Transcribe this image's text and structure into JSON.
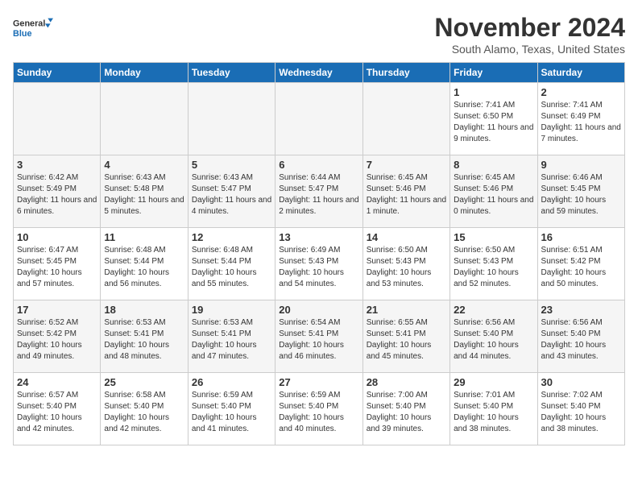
{
  "logo": {
    "line1": "General",
    "line2": "Blue"
  },
  "title": "November 2024",
  "location": "South Alamo, Texas, United States",
  "days_header": [
    "Sunday",
    "Monday",
    "Tuesday",
    "Wednesday",
    "Thursday",
    "Friday",
    "Saturday"
  ],
  "weeks": [
    [
      {
        "day": "",
        "text": "",
        "empty": true
      },
      {
        "day": "",
        "text": "",
        "empty": true
      },
      {
        "day": "",
        "text": "",
        "empty": true
      },
      {
        "day": "",
        "text": "",
        "empty": true
      },
      {
        "day": "",
        "text": "",
        "empty": true
      },
      {
        "day": "1",
        "text": "Sunrise: 7:41 AM\nSunset: 6:50 PM\nDaylight: 11 hours and 9 minutes.",
        "empty": false
      },
      {
        "day": "2",
        "text": "Sunrise: 7:41 AM\nSunset: 6:49 PM\nDaylight: 11 hours and 7 minutes.",
        "empty": false
      }
    ],
    [
      {
        "day": "3",
        "text": "Sunrise: 6:42 AM\nSunset: 5:49 PM\nDaylight: 11 hours and 6 minutes.",
        "empty": false
      },
      {
        "day": "4",
        "text": "Sunrise: 6:43 AM\nSunset: 5:48 PM\nDaylight: 11 hours and 5 minutes.",
        "empty": false
      },
      {
        "day": "5",
        "text": "Sunrise: 6:43 AM\nSunset: 5:47 PM\nDaylight: 11 hours and 4 minutes.",
        "empty": false
      },
      {
        "day": "6",
        "text": "Sunrise: 6:44 AM\nSunset: 5:47 PM\nDaylight: 11 hours and 2 minutes.",
        "empty": false
      },
      {
        "day": "7",
        "text": "Sunrise: 6:45 AM\nSunset: 5:46 PM\nDaylight: 11 hours and 1 minute.",
        "empty": false
      },
      {
        "day": "8",
        "text": "Sunrise: 6:45 AM\nSunset: 5:46 PM\nDaylight: 11 hours and 0 minutes.",
        "empty": false
      },
      {
        "day": "9",
        "text": "Sunrise: 6:46 AM\nSunset: 5:45 PM\nDaylight: 10 hours and 59 minutes.",
        "empty": false
      }
    ],
    [
      {
        "day": "10",
        "text": "Sunrise: 6:47 AM\nSunset: 5:45 PM\nDaylight: 10 hours and 57 minutes.",
        "empty": false
      },
      {
        "day": "11",
        "text": "Sunrise: 6:48 AM\nSunset: 5:44 PM\nDaylight: 10 hours and 56 minutes.",
        "empty": false
      },
      {
        "day": "12",
        "text": "Sunrise: 6:48 AM\nSunset: 5:44 PM\nDaylight: 10 hours and 55 minutes.",
        "empty": false
      },
      {
        "day": "13",
        "text": "Sunrise: 6:49 AM\nSunset: 5:43 PM\nDaylight: 10 hours and 54 minutes.",
        "empty": false
      },
      {
        "day": "14",
        "text": "Sunrise: 6:50 AM\nSunset: 5:43 PM\nDaylight: 10 hours and 53 minutes.",
        "empty": false
      },
      {
        "day": "15",
        "text": "Sunrise: 6:50 AM\nSunset: 5:43 PM\nDaylight: 10 hours and 52 minutes.",
        "empty": false
      },
      {
        "day": "16",
        "text": "Sunrise: 6:51 AM\nSunset: 5:42 PM\nDaylight: 10 hours and 50 minutes.",
        "empty": false
      }
    ],
    [
      {
        "day": "17",
        "text": "Sunrise: 6:52 AM\nSunset: 5:42 PM\nDaylight: 10 hours and 49 minutes.",
        "empty": false
      },
      {
        "day": "18",
        "text": "Sunrise: 6:53 AM\nSunset: 5:41 PM\nDaylight: 10 hours and 48 minutes.",
        "empty": false
      },
      {
        "day": "19",
        "text": "Sunrise: 6:53 AM\nSunset: 5:41 PM\nDaylight: 10 hours and 47 minutes.",
        "empty": false
      },
      {
        "day": "20",
        "text": "Sunrise: 6:54 AM\nSunset: 5:41 PM\nDaylight: 10 hours and 46 minutes.",
        "empty": false
      },
      {
        "day": "21",
        "text": "Sunrise: 6:55 AM\nSunset: 5:41 PM\nDaylight: 10 hours and 45 minutes.",
        "empty": false
      },
      {
        "day": "22",
        "text": "Sunrise: 6:56 AM\nSunset: 5:40 PM\nDaylight: 10 hours and 44 minutes.",
        "empty": false
      },
      {
        "day": "23",
        "text": "Sunrise: 6:56 AM\nSunset: 5:40 PM\nDaylight: 10 hours and 43 minutes.",
        "empty": false
      }
    ],
    [
      {
        "day": "24",
        "text": "Sunrise: 6:57 AM\nSunset: 5:40 PM\nDaylight: 10 hours and 42 minutes.",
        "empty": false
      },
      {
        "day": "25",
        "text": "Sunrise: 6:58 AM\nSunset: 5:40 PM\nDaylight: 10 hours and 42 minutes.",
        "empty": false
      },
      {
        "day": "26",
        "text": "Sunrise: 6:59 AM\nSunset: 5:40 PM\nDaylight: 10 hours and 41 minutes.",
        "empty": false
      },
      {
        "day": "27",
        "text": "Sunrise: 6:59 AM\nSunset: 5:40 PM\nDaylight: 10 hours and 40 minutes.",
        "empty": false
      },
      {
        "day": "28",
        "text": "Sunrise: 7:00 AM\nSunset: 5:40 PM\nDaylight: 10 hours and 39 minutes.",
        "empty": false
      },
      {
        "day": "29",
        "text": "Sunrise: 7:01 AM\nSunset: 5:40 PM\nDaylight: 10 hours and 38 minutes.",
        "empty": false
      },
      {
        "day": "30",
        "text": "Sunrise: 7:02 AM\nSunset: 5:40 PM\nDaylight: 10 hours and 38 minutes.",
        "empty": false
      }
    ]
  ]
}
